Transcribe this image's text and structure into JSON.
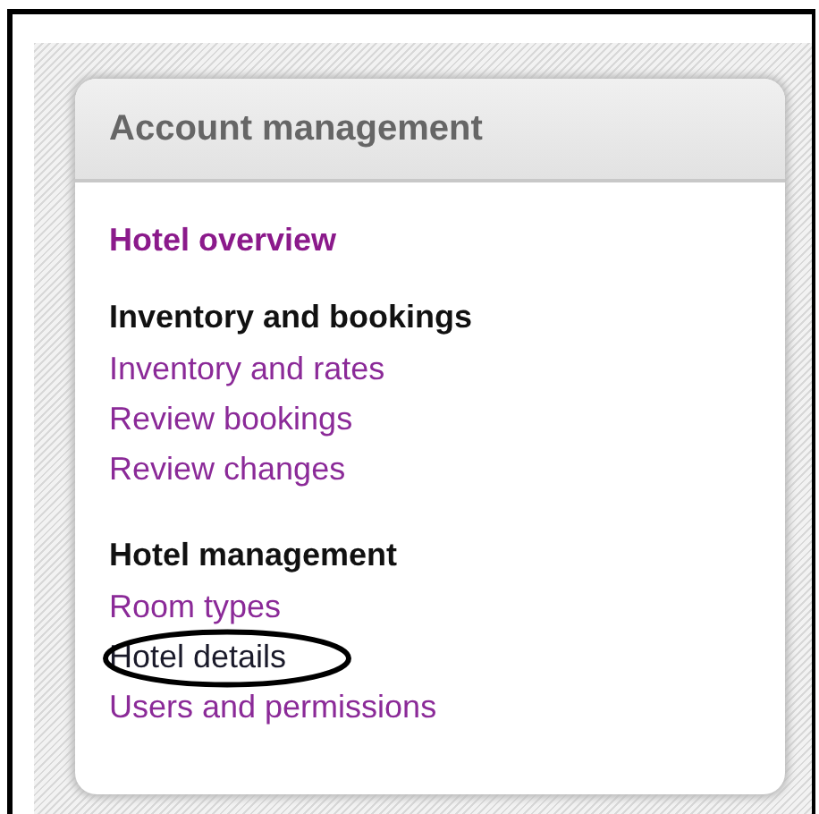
{
  "panel": {
    "title": "Account management"
  },
  "nav": [
    {
      "kind": "top-link",
      "label": "Hotel overview",
      "selected": false
    },
    {
      "kind": "section",
      "heading": "Inventory and bookings",
      "items": [
        {
          "label": "Inventory and rates",
          "selected": false,
          "circled": false
        },
        {
          "label": "Review bookings",
          "selected": false,
          "circled": false
        },
        {
          "label": "Review changes",
          "selected": false,
          "circled": false
        }
      ]
    },
    {
      "kind": "section",
      "heading": "Hotel management",
      "items": [
        {
          "label": "Room types",
          "selected": false,
          "circled": false
        },
        {
          "label": "Hotel details",
          "selected": true,
          "circled": true
        },
        {
          "label": "Users and permissions",
          "selected": false,
          "circled": false
        }
      ]
    }
  ]
}
